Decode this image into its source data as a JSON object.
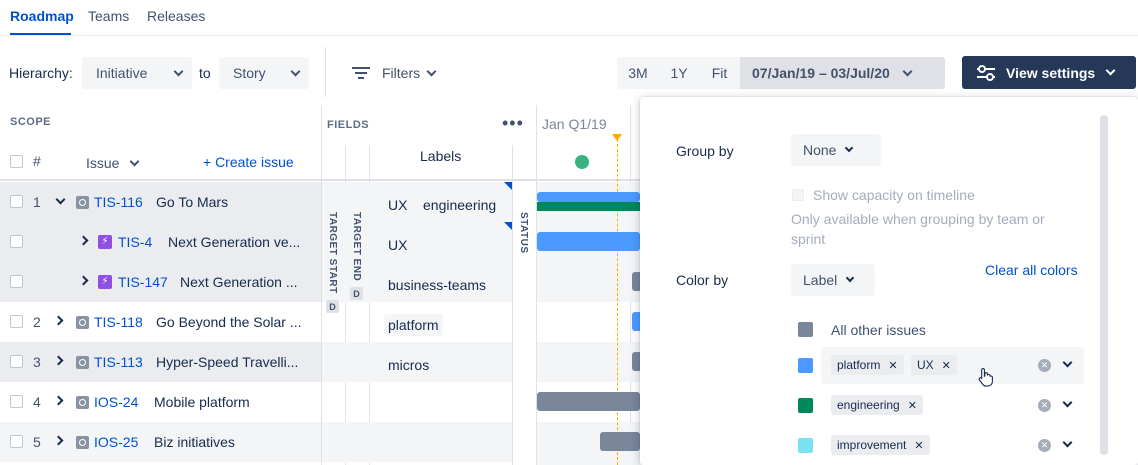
{
  "tabs": [
    "Roadmap",
    "Teams",
    "Releases"
  ],
  "toolbar": {
    "hierarchy_label": "Hierarchy:",
    "from_value": "Initiative",
    "to_label": "to",
    "to_value": "Story",
    "filters_label": "Filters",
    "zoom_options": [
      "3M",
      "1Y",
      "Fit"
    ],
    "date_range": "07/Jan/19 – 03/Jul/20",
    "view_settings_label": "View settings"
  },
  "table": {
    "scope_label": "SCOPE",
    "hash_label": "#",
    "issue_label": "Issue",
    "create_issue_label": "+ Create issue",
    "fields_label": "FIELDS",
    "more_icon": "more-icon",
    "labels_header": "Labels",
    "target_start_label": "TARGET START",
    "target_end_label": "TARGET END",
    "status_label": "STATUS",
    "d_badge": "D",
    "timeline_header": "Jan Q1/19",
    "rows": [
      {
        "num": "1",
        "key": "TIS-116",
        "title": "Go To Mars",
        "type": "initiative",
        "expanded": true,
        "labels": [
          "UX",
          "engineering"
        ]
      },
      {
        "num": "",
        "key": "TIS-4",
        "title": "Next Generation ve...",
        "type": "epic",
        "expanded": false,
        "labels": [
          "UX"
        ]
      },
      {
        "num": "",
        "key": "TIS-147",
        "title": "Next Generation ...",
        "type": "epic",
        "expanded": false,
        "labels": [
          "business-teams"
        ]
      },
      {
        "num": "2",
        "key": "TIS-118",
        "title": "Go Beyond the Solar ...",
        "type": "initiative",
        "expanded": false,
        "labels": [
          "platform"
        ]
      },
      {
        "num": "3",
        "key": "TIS-113",
        "title": "Hyper-Speed Travelli...",
        "type": "initiative",
        "expanded": false,
        "labels": [
          "micros"
        ]
      },
      {
        "num": "4",
        "key": "IOS-24",
        "title": "Mobile platform",
        "type": "initiative",
        "expanded": false,
        "labels": []
      },
      {
        "num": "5",
        "key": "IOS-25",
        "title": "Biz initiatives",
        "type": "initiative",
        "expanded": false,
        "labels": []
      }
    ]
  },
  "settings": {
    "group_by_label": "Group by",
    "group_by_value": "None",
    "show_capacity_label": "Show capacity on timeline",
    "capacity_note": "Only available when grouping by team or sprint",
    "color_by_label": "Color by",
    "color_by_value": "Label",
    "clear_all_label": "Clear all colors",
    "color_rows": [
      {
        "color": "#7a869a",
        "text": "All other issues",
        "chips": []
      },
      {
        "color": "#4c9aff",
        "text": "",
        "chips": [
          "platform",
          "UX"
        ]
      },
      {
        "color": "#00875a",
        "text": "",
        "chips": [
          "engineering"
        ]
      },
      {
        "color": "#79e2f2",
        "text": "",
        "chips": [
          "improvement"
        ]
      }
    ]
  },
  "colors": {
    "accent": "#0052cc",
    "dark_button": "#253858",
    "bar_blue": "#4c9aff",
    "bar_green": "#00875a",
    "bar_gray": "#7a869a",
    "today_line": "#ffab00",
    "status_dot": "#36b37e"
  }
}
